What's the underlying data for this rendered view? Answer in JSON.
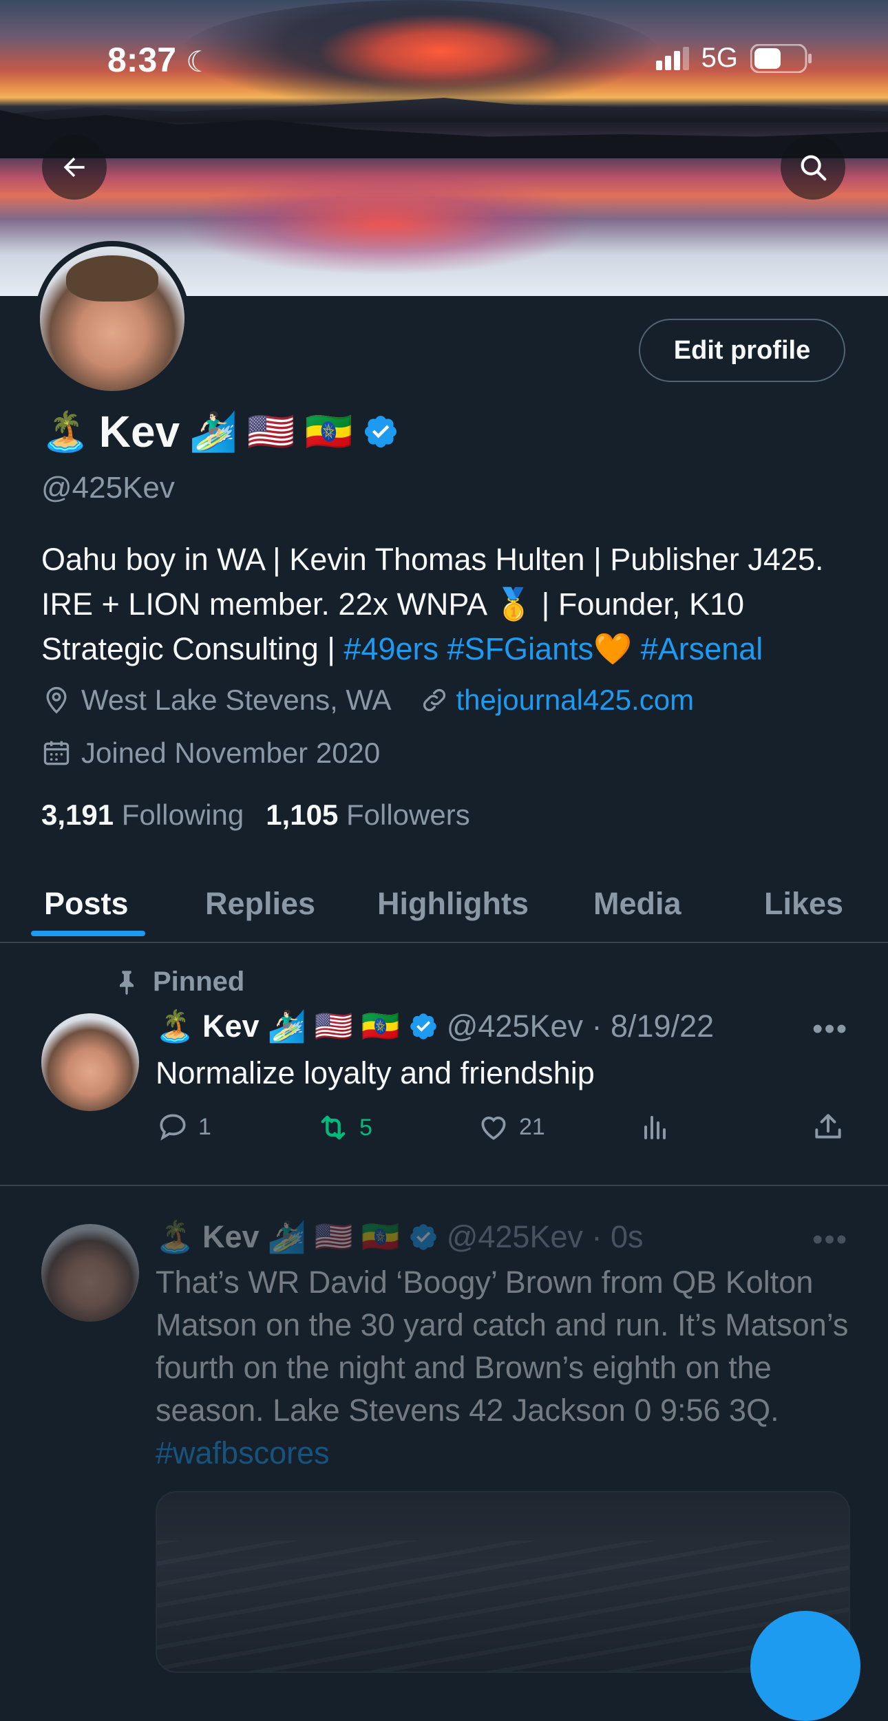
{
  "status_bar": {
    "time": "8:37",
    "network": "5G"
  },
  "profile": {
    "name": "Kev",
    "name_emoji_before": "🏝️",
    "name_emoji_after": [
      "🏄🏻‍♂️",
      "🇺🇸",
      "🇪🇹"
    ],
    "handle": "@425Kev",
    "bio_text": "Oahu boy in WA | Kevin Thomas Hulten | Publisher J425. IRE + LION member. 22x WNPA 🥇 | Founder, K10 Strategic Consulting | ",
    "bio_tags": [
      "#49ers",
      "#SFGiants",
      "#Arsenal"
    ],
    "bio_tag_emoji": "🧡",
    "location": "West Lake Stevens, WA",
    "website": "thejournal425.com",
    "joined": "Joined November 2020",
    "following_count": "3,191",
    "following_label": "Following",
    "followers_count": "1,105",
    "followers_label": "Followers",
    "edit_profile_label": "Edit profile"
  },
  "tabs": [
    "Posts",
    "Replies",
    "Highlights",
    "Media",
    "Likes"
  ],
  "pinned_post": {
    "pinned_label": "Pinned",
    "name": "Kev",
    "handle_time": "@425Kev · 8/19/22",
    "text": "Normalize loyalty and friendship",
    "replies": "1",
    "reposts": "5",
    "likes": "21"
  },
  "post2": {
    "name": "Kev",
    "handle_time": "@425Kev · 0s",
    "text": "That’s WR David ‘Boogy’ Brown from QB Kolton Matson on the 30 yard catch and run. It’s Matson’s fourth on the night and Brown’s eighth on the season. Lake Stevens 42 Jackson 0 9:56 3Q. ",
    "tag": "#wafbscores"
  },
  "colors": {
    "accent": "#1d9bf0",
    "background": "#15202b",
    "muted": "#8b98a5",
    "repost_active": "#00ba7c"
  }
}
